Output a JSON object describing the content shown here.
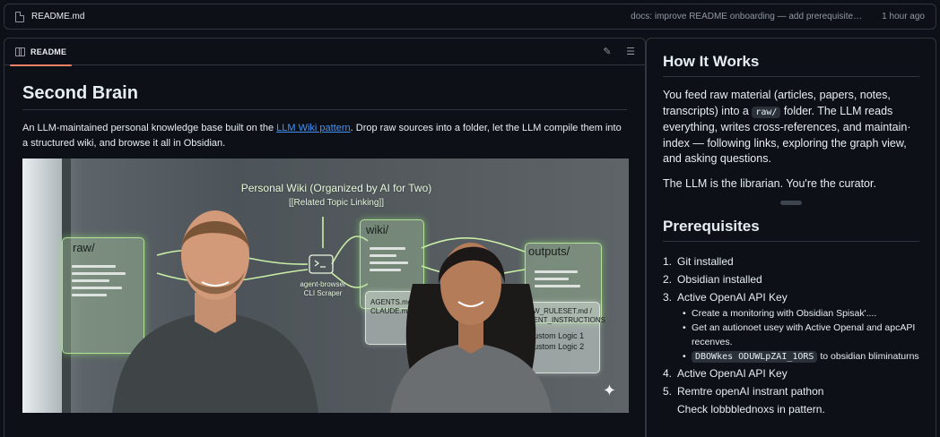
{
  "file_bar": {
    "filename": "README.md",
    "commit_message": "docs: improve README onboarding — add prerequisites, fi...",
    "time": "1 hour ago"
  },
  "readme": {
    "tab_label": "README",
    "title": "Second Brain",
    "intro_before": "An LLM-maintained personal knowledge base built on the ",
    "intro_link": "LLM Wiki pattern",
    "intro_after": ". Drop raw sources into a folder, let the LLM compile them into a structured wiki, and browse it all in Obsidian.",
    "illustration": {
      "heading": "Personal Wiki (Organized by AI for Two)",
      "subheading": "[[Related Topic Linking]]",
      "panel_raw": "raw/",
      "panel_wiki": "wiki/",
      "panel_outputs": "outputs/",
      "scraper_label_1": "agent-browser",
      "scraper_label_2": "CLI Scraper",
      "agents_1": "AGENTS.md /",
      "agents_2": "CLAUDE.md",
      "ruleset_1": "NEW_RULESET.md /",
      "ruleset_2": "AGENT_INSTRUCTIONS",
      "custom_1": "Custom Logic 1",
      "custom_2": "Custom Logic 2"
    }
  },
  "side": {
    "how_title": "How It Works",
    "how_p1_a": "You feed raw material (articles, papers, notes, transcripts) into a ",
    "how_p1_code": "raw/",
    "how_p1_b": " folder. The LLM reads everything, writes cross-references, and maintain· index — following links, exploring the graph view, and asking questions.",
    "how_p2": "The LLM is the librarian. You're the curator.",
    "prereq_title": "Prerequisites",
    "items": [
      {
        "num": "1.",
        "text": "Git installed"
      },
      {
        "num": "2.",
        "text": "Obsidian installed"
      },
      {
        "num": "3.",
        "text": "Active OpenAI API Key"
      }
    ],
    "sub_items": [
      "Create a monitoring with Obsidian Spisak'....",
      "Get an autionoet usey with Active Openal and apcAPI recenves.",
      "to obsidian bliminaturns"
    ],
    "sub_code": "DBOWkes ODUWLpZAI_1ORS",
    "item4_num": "4.",
    "item4": "Active OpenAI API Key",
    "item5_num": "5.",
    "item5": "Remtre openAI instrant pathon",
    "item5_line2": "Check lobbblednoxs in pattern."
  }
}
